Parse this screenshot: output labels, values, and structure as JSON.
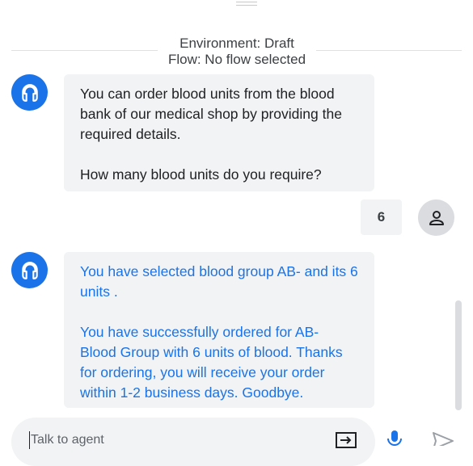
{
  "environment": {
    "line1": "Environment: Draft",
    "line2": "Flow: No flow selected"
  },
  "messages": [
    {
      "role": "agent",
      "icon": "headset-icon",
      "paragraphs": [
        "You can order blood units from the blood bank of our medical shop by providing the required details.",
        "How many blood units do you require?"
      ]
    },
    {
      "role": "user",
      "icon": "person-icon",
      "text": "6"
    },
    {
      "role": "agent",
      "icon": "headset-icon",
      "paragraphs": [
        "You have selected blood group AB- and its 6 units .",
        "You have successfully ordered for AB- Blood Group with 6 units of blood. Thanks for ordering, you will receive your order within 1-2 business days. Goodbye."
      ]
    }
  ],
  "input": {
    "placeholder": "Talk to agent",
    "value": ""
  },
  "colors": {
    "accent": "#1a73e8",
    "bubble_bg": "#f1f3f4",
    "user_avatar_bg": "#dadce0"
  }
}
